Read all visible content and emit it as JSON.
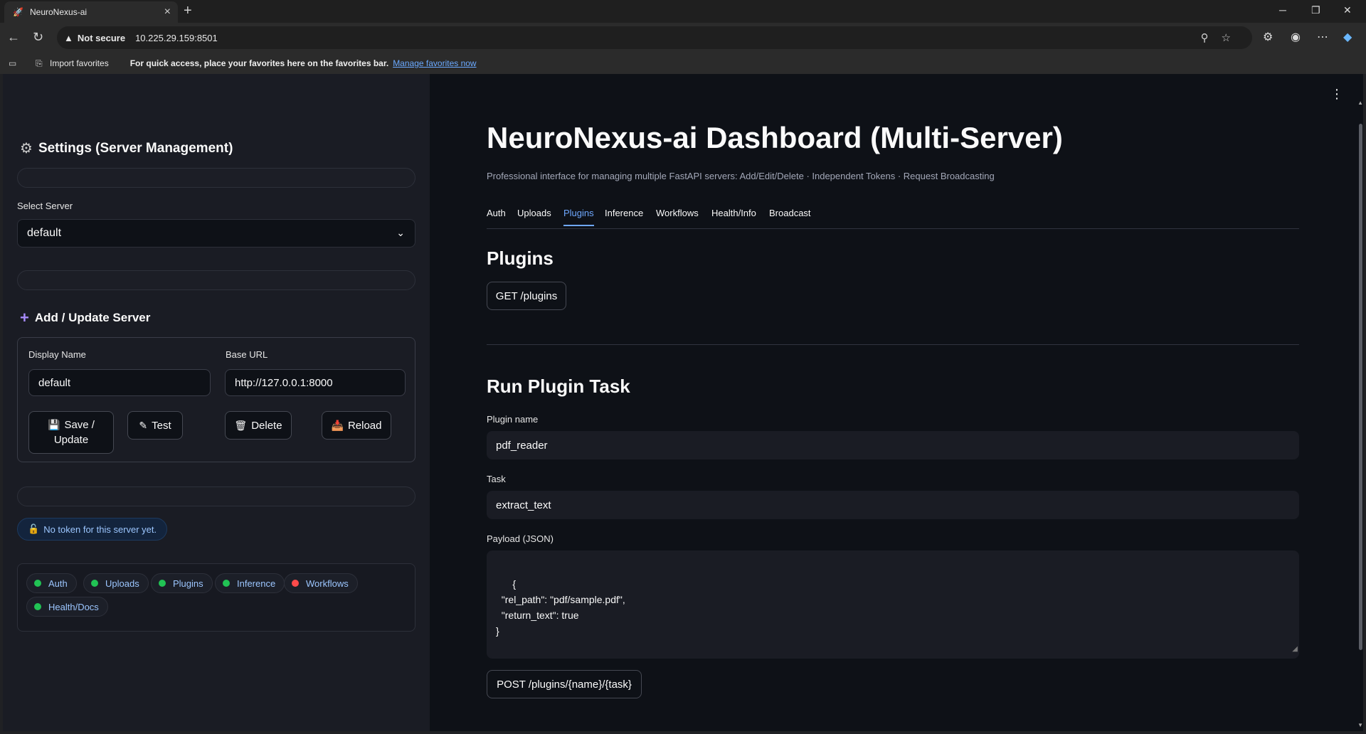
{
  "browser": {
    "tab_title": "NeuroNexus-ai",
    "not_secure": "Not secure",
    "url": "10.225.29.159:8501",
    "import_favorites": "Import favorites",
    "favorites_message": "For quick access, place your favorites here on the favorites bar.",
    "manage_favorites": "Manage favorites now"
  },
  "sidebar": {
    "settings_title": "Settings (Server Management)",
    "select_server_label": "Select Server",
    "selected_server": "default",
    "add_update_title": "Add / Update Server",
    "display_name_label": "Display Name",
    "display_name_value": "default",
    "base_url_label": "Base URL",
    "base_url_value": "http://127.0.0.1:8000",
    "save_label_1": "Save /",
    "save_label_2": "Update",
    "test_label": "Test",
    "delete_label": "Delete",
    "reload_label": "Reload",
    "token_message": "No token for this server yet.",
    "status_chips": [
      {
        "label": "Auth",
        "color": "#21c354"
      },
      {
        "label": "Uploads",
        "color": "#21c354"
      },
      {
        "label": "Plugins",
        "color": "#21c354"
      },
      {
        "label": "Inference",
        "color": "#21c354"
      },
      {
        "label": "Workflows",
        "color": "#ff4b4b"
      },
      {
        "label": "Health/Docs",
        "color": "#21c354"
      }
    ]
  },
  "main": {
    "title": "NeuroNexus-ai Dashboard (Multi-Server)",
    "subtitle": "Professional interface for managing multiple FastAPI servers: Add/Edit/Delete · Independent Tokens · Request Broadcasting",
    "tabs": [
      "Auth",
      "Uploads",
      "Plugins",
      "Inference",
      "Workflows",
      "Health/Info",
      "Broadcast"
    ],
    "active_tab": "Plugins",
    "plugins_heading": "Plugins",
    "get_plugins_button": "GET /plugins",
    "run_task_heading": "Run Plugin Task",
    "plugin_name_label": "Plugin name",
    "plugin_name_value": "pdf_reader",
    "task_label": "Task",
    "task_value": "extract_text",
    "payload_label": "Payload (JSON)",
    "payload_value": "{\n  \"rel_path\": \"pdf/sample.pdf\",\n  \"return_text\": true\n}",
    "post_button": "POST /plugins/{name}/{task}"
  }
}
